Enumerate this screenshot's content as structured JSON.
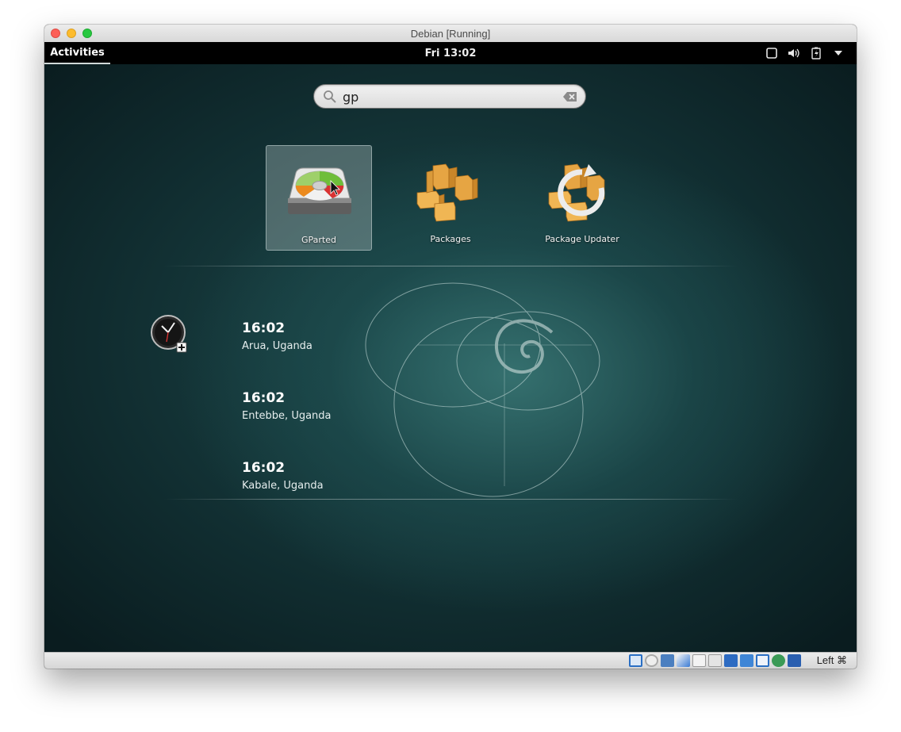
{
  "window": {
    "title": "Debian [Running]"
  },
  "topbar": {
    "activities": "Activities",
    "clock": "Fri 13:02"
  },
  "search": {
    "value": "gp",
    "placeholder": ""
  },
  "apps": [
    {
      "label": "GParted",
      "icon": "gparted-icon",
      "selected": true
    },
    {
      "label": "Packages",
      "icon": "packages-icon",
      "selected": false
    },
    {
      "label": "Package Updater",
      "icon": "package-updater-icon",
      "selected": false
    }
  ],
  "clock_results": [
    {
      "time": "16:02",
      "place": "Arua, Uganda"
    },
    {
      "time": "16:02",
      "place": "Entebbe, Uganda"
    },
    {
      "time": "16:02",
      "place": "Kabale, Uganda"
    }
  ],
  "statusbar": {
    "host_key": "Left ⌘"
  },
  "colors": {
    "accent_selected": "#96aaaa",
    "background_teal": "#1d4a4c",
    "topbar": "#000000"
  }
}
